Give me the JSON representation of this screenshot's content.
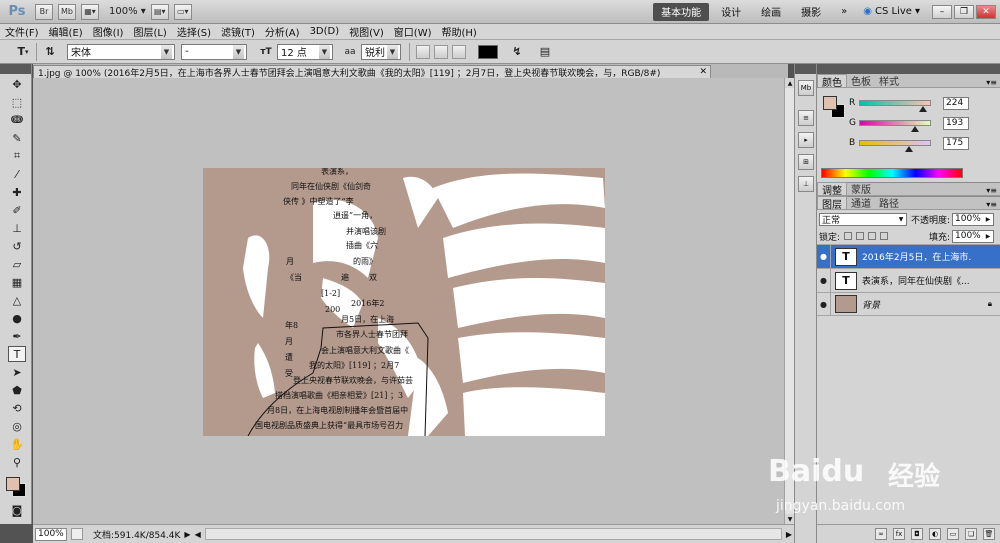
{
  "appbar": {
    "logo": "Ps",
    "bridge_btn": "Br",
    "minibridge_btn": "Mb",
    "zoom": "100%",
    "workspaces": [
      {
        "label": "基本功能",
        "active": true
      },
      {
        "label": "设计",
        "active": false
      },
      {
        "label": "绘画",
        "active": false
      },
      {
        "label": "摄影",
        "active": false
      }
    ],
    "more": "»",
    "cslive": "CS Live"
  },
  "menu": [
    "文件(F)",
    "编辑(E)",
    "图像(I)",
    "图层(L)",
    "选择(S)",
    "滤镜(T)",
    "分析(A)",
    "3D(D)",
    "视图(V)",
    "窗口(W)",
    "帮助(H)"
  ],
  "options": {
    "tool_glyph": "T",
    "font_family": "宋体",
    "font_style": "-",
    "font_size": "12 点",
    "aa_label": "aa",
    "antialias": "锐利",
    "text_color": "#000000"
  },
  "document": {
    "tab_title": "1.jpg @ 100% (2016年2月5日，在上海市各界人士春节团拜会上演唱意大利文歌曲《我的太阳》[119] ；2月7日，登上央视春节联欢晚会，与，RGB/8#)",
    "photo_bg": "#b49a8d",
    "text_lines": [
      "表演系，",
      "同年在仙侠剧《仙剑奇",
      "侠传      》中塑造了“李",
      "逍遥”一角，",
      "并演唱该剧",
      "插曲《六",
      "月",
      "的雨》",
      "《当",
      "遍",
      "双",
      "[1-2]",
      "2016年2",
      "200",
      "月5日，在上海",
      "年8",
      "市各界人士春节团拜",
      "月",
      "会上演唱意大利文歌曲《",
      "遭",
      "我的太阳》[119] ；2月7",
      "受",
      "登上央视春节联欢晚会，与许茹芸",
      "搭档演唱歌曲《相亲相爱》[21] ；3",
      "月8日，在上海电视剧制播年会暨首届中",
      "国电视剧品质盛典上获得“最具市场号召力"
    ]
  },
  "status": {
    "zoom": "100%",
    "doc_info": "文档:591.4K/854.4K"
  },
  "color_panel": {
    "tabs": [
      "颜色",
      "色板",
      "样式"
    ],
    "fg": "#e0c1af",
    "bg": "#000000",
    "channels": [
      {
        "label": "R",
        "value": "224",
        "fraction": 0.878
      },
      {
        "label": "G",
        "value": "193",
        "fraction": 0.757
      },
      {
        "label": "B",
        "value": "175",
        "fraction": 0.686
      }
    ]
  },
  "adjust_tabs": [
    "调整",
    "蒙版"
  ],
  "layers_panel": {
    "tabs": [
      "图层",
      "通道",
      "路径"
    ],
    "blend_mode": "正常",
    "opacity_label": "不透明度:",
    "opacity": "100%",
    "lock_label": "锁定:",
    "fill_label": "填充:",
    "fill": "100%",
    "layers": [
      {
        "name": "2016年2月5日，在上海市...",
        "type": "T",
        "selected": true
      },
      {
        "name": "表演系，同年在仙侠剧《...",
        "type": "T",
        "selected": false
      },
      {
        "name": "背景",
        "type": "image",
        "selected": false
      }
    ]
  },
  "watermark": {
    "brand": "Baidu",
    "cn": "经验",
    "url": "jingyan.baidu.com"
  }
}
